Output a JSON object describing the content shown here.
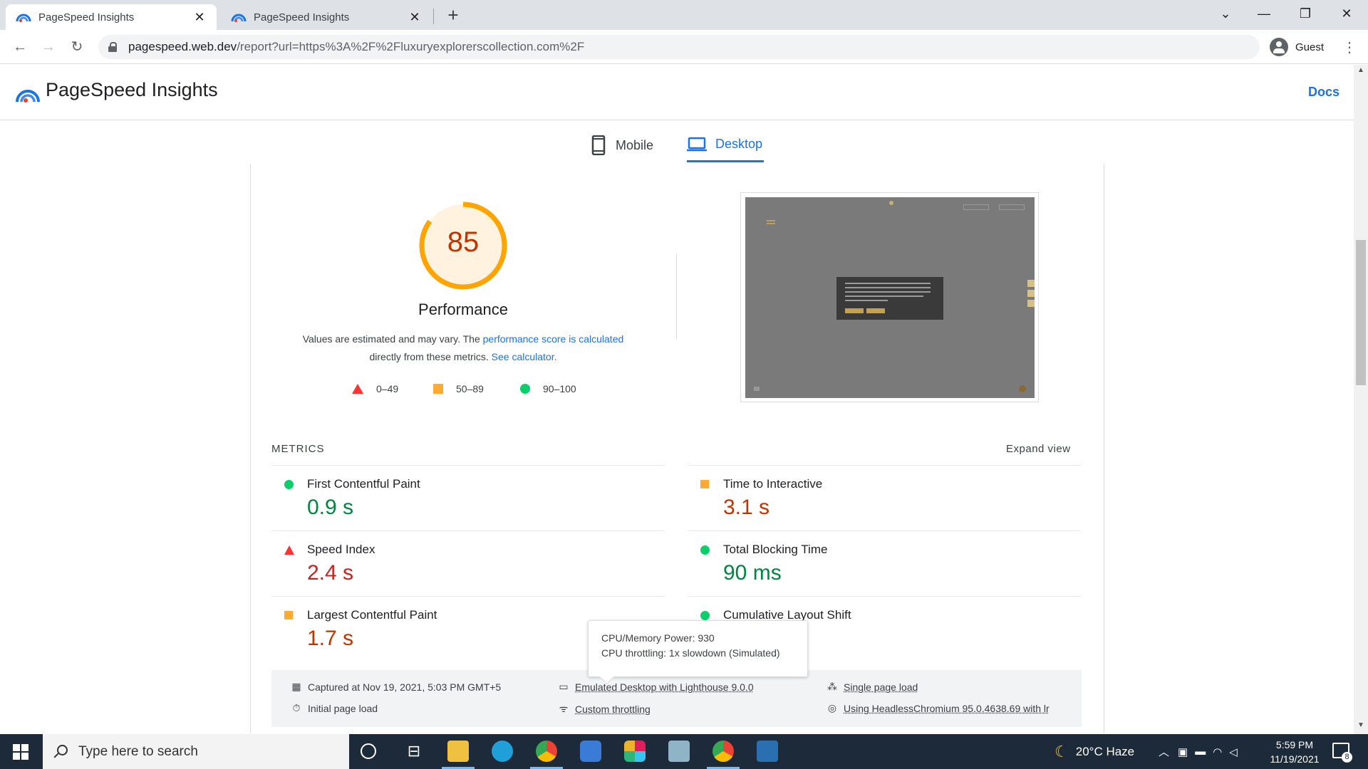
{
  "browser": {
    "tabs": [
      {
        "title": "PageSpeed Insights",
        "close": "✕"
      },
      {
        "title": "PageSpeed Insights",
        "close": "✕"
      }
    ],
    "new_tab": "+",
    "url_host": "pagespeed.web.dev",
    "url_path": "/report?url=https%3A%2F%2Fluxuryexplorerscollection.com%2F",
    "profile": "Guest"
  },
  "header": {
    "title": "PageSpeed Insights",
    "docs": "Docs"
  },
  "device_tabs": {
    "mobile": "Mobile",
    "desktop": "Desktop",
    "selected": "Desktop"
  },
  "performance": {
    "score": "85",
    "score_value": 85,
    "label": "Performance",
    "desc_1": "Values are estimated and may vary. The ",
    "desc_link_1": "performance score is calculated",
    "desc_2": "directly from these metrics. ",
    "desc_link_2": "See calculator.",
    "legend": [
      {
        "range": "0–49",
        "shape": "triangle",
        "color": "#ff3333"
      },
      {
        "range": "50–89",
        "shape": "square",
        "color": "#ffaa33"
      },
      {
        "range": "90–100",
        "shape": "circle",
        "color": "#0cce6b"
      }
    ]
  },
  "metrics": {
    "heading": "METRICS",
    "expand": "Expand view",
    "items": [
      {
        "name": "First Contentful Paint",
        "value": "0.9 s",
        "status": "good"
      },
      {
        "name": "Time to Interactive",
        "value": "3.1 s",
        "status": "average"
      },
      {
        "name": "Speed Index",
        "value": "2.4 s",
        "status": "poor"
      },
      {
        "name": "Total Blocking Time",
        "value": "90 ms",
        "status": "good"
      },
      {
        "name": "Largest Contentful Paint",
        "value": "1.7 s",
        "status": "average"
      },
      {
        "name": "Cumulative Layout Shift",
        "value": "",
        "status": "good"
      }
    ]
  },
  "info": {
    "captured": "Captured at Nov 19, 2021, 5:03 PM GMT+5",
    "initial_load": "Initial page load",
    "emulated": "Emulated Desktop with Lighthouse 9.0.0",
    "throttling": "Custom throttling",
    "single_load": "Single page load",
    "browser": "Using HeadlessChromium 95.0.4638.69 with lr"
  },
  "tooltip": {
    "line1": "CPU/Memory Power: 930",
    "line2": "CPU throttling: 1x slowdown (Simulated)"
  },
  "taskbar": {
    "search_placeholder": "Type here to search",
    "weather": "20°C  Haze",
    "time": "5:59 PM",
    "date": "11/19/2021",
    "notifications": "8"
  }
}
